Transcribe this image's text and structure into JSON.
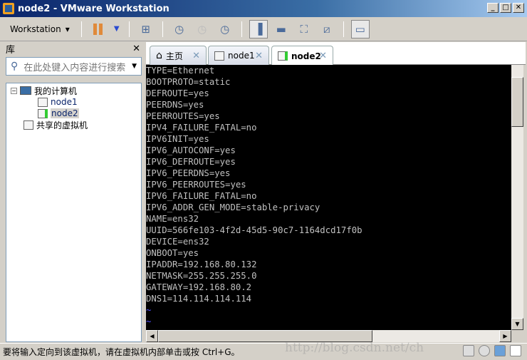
{
  "window": {
    "title": "node2 - VMware Workstation",
    "minimize": "_",
    "maximize": "□",
    "close": "✕"
  },
  "toolbar": {
    "workstation_label": "Workstation",
    "dropdown": "▾"
  },
  "library": {
    "title": "库",
    "close": "✕",
    "search_placeholder": "在此处键入内容进行搜索",
    "tree": {
      "my_computer": "我的计算机",
      "expander": "−",
      "vms": [
        "node1",
        "node2"
      ],
      "shared": "共享的虚拟机",
      "selected": "node2"
    }
  },
  "tabs": [
    {
      "label": "主页",
      "icon": "home-icon"
    },
    {
      "label": "node1",
      "icon": "vm-icon"
    },
    {
      "label": "node2",
      "icon": "vm-running-icon",
      "active": true
    }
  ],
  "tab_close": "✕",
  "terminal": {
    "lines": [
      "TYPE=Ethernet",
      "BOOTPROTO=static",
      "DEFROUTE=yes",
      "PEERDNS=yes",
      "PEERROUTES=yes",
      "IPV4_FAILURE_FATAL=no",
      "IPV6INIT=yes",
      "IPV6_AUTOCONF=yes",
      "IPV6_DEFROUTE=yes",
      "IPV6_PEERDNS=yes",
      "IPV6_PEERROUTES=yes",
      "IPV6_FAILURE_FATAL=no",
      "IPV6_ADDR_GEN_MODE=stable-privacy",
      "NAME=ens32",
      "UUID=566fe103-4f2d-45d5-90c7-1164dcd17f0b",
      "DEVICE=ens32",
      "ONBOOT=yes",
      "IPADDR=192.168.80.132",
      "NETMASK=255.255.255.0",
      "GATEWAY=192.168.80.2",
      "DNS1=114.114.114.114"
    ],
    "tilde_lines": [
      "~",
      "~",
      "~"
    ]
  },
  "status": {
    "text": "要将输入定向到该虚拟机，请在虚拟机内部单击或按 Ctrl+G。"
  },
  "watermark": "http://blog.csdn.net/ch"
}
